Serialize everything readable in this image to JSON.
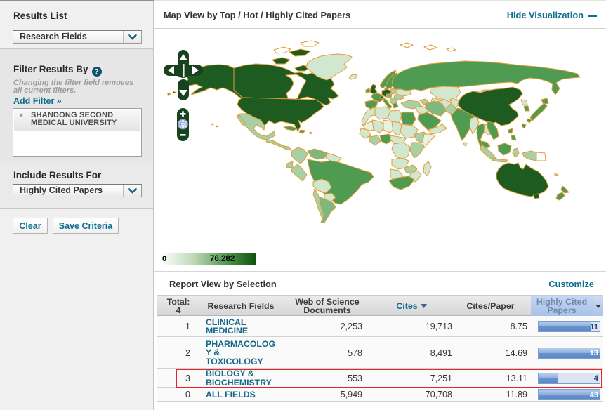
{
  "sidebar": {
    "results_list": {
      "label": "Results List",
      "selected": "Research Fields"
    },
    "filter": {
      "label": "Filter Results By",
      "help_icon": "?",
      "hint": "Changing the filter field removes all current filters.",
      "add_filter_label": "Add Filter »",
      "chips": [
        {
          "remove_icon": "×",
          "text": "SHANDONG SECOND MEDICAL UNIVERSITY"
        }
      ]
    },
    "include_results": {
      "label": "Include Results For",
      "selected": "Highly Cited Papers"
    },
    "buttons": {
      "clear": "Clear",
      "save": "Save Criteria"
    }
  },
  "map": {
    "title": "Map View by Top / Hot / Highly Cited Papers",
    "hide_link": "Hide Visualization",
    "legend": {
      "min": "0",
      "max": "76,282"
    },
    "palette": {
      "none": "#ffffff",
      "very_low": "#e7f2e3",
      "low": "#d2e7cf",
      "medium_low": "#a8cfa6",
      "medium": "#7db97e",
      "high": "#4e9b51",
      "very_high": "#1d5b20",
      "border": "#e29d36"
    },
    "controls": [
      "pan-up",
      "pan-down",
      "pan-left",
      "pan-right",
      "zoom-in",
      "globe",
      "zoom-out"
    ]
  },
  "report": {
    "title": "Report View by Selection",
    "customize_link": "Customize",
    "table": {
      "total_label": "Total:",
      "total_value": "4",
      "columns": [
        "Research Fields",
        "Web of Science Documents",
        "Cites",
        "Cites/Paper",
        "Highly Cited Papers"
      ],
      "sorted_column": "Cites",
      "rows": [
        {
          "rank": "1",
          "field": "CLINICAL MEDICINE",
          "field_lines": [
            "CLINICAL",
            "MEDICINE"
          ],
          "docs": "2,253",
          "cites": "19,713",
          "cites_per_paper": "8.75",
          "hcp": "11",
          "bar_pct": 84.6,
          "highlighted": false
        },
        {
          "rank": "2",
          "field": "PHARMACOLOGY & TOXICOLOGY",
          "field_lines": [
            "PHARMACOLOG",
            "Y &",
            "TOXICOLOGY"
          ],
          "docs": "578",
          "cites": "8,491",
          "cites_per_paper": "14.69",
          "hcp": "13",
          "bar_pct": 100,
          "highlighted": false
        },
        {
          "rank": "3",
          "field": "BIOLOGY & BIOCHEMISTRY",
          "field_lines": [
            "BIOLOGY &",
            "BIOCHEMISTRY"
          ],
          "docs": "553",
          "cites": "7,251",
          "cites_per_paper": "13.11",
          "hcp": "4",
          "bar_pct": 30.8,
          "highlighted": true
        },
        {
          "rank": "0",
          "field": "ALL FIELDS",
          "field_lines": [
            "ALL FIELDS"
          ],
          "docs": "5,949",
          "cites": "70,708",
          "cites_per_paper": "11.89",
          "hcp": "43",
          "bar_pct": 100,
          "highlighted": false
        }
      ]
    }
  }
}
